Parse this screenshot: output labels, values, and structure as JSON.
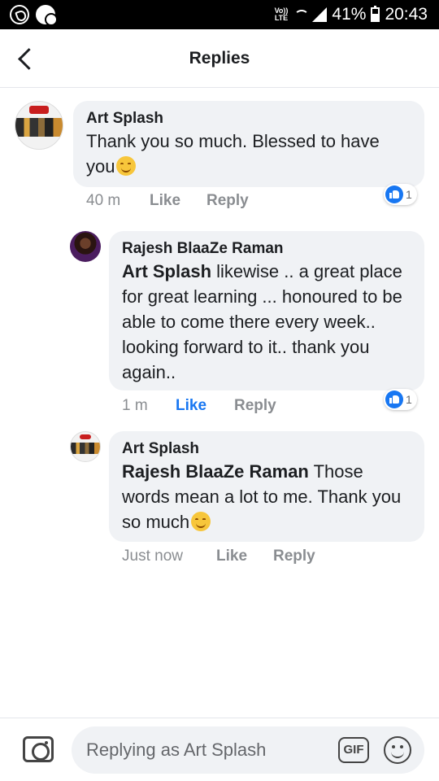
{
  "status_bar": {
    "volte_line1": "Vo))",
    "volte_line2": "LTE",
    "battery": "41%",
    "time": "20:43",
    "icons": [
      "whatsapp-icon",
      "chat-icon",
      "volte-icon",
      "wifi-icon",
      "signal-icon",
      "battery-icon"
    ]
  },
  "header": {
    "title": "Replies",
    "back_icon": "chevron-left-icon"
  },
  "comments": [
    {
      "author": "Art Splash",
      "avatar": "art-splash-avatar",
      "text_prefix": "Thank you so much. Blessed to have you",
      "emoji": "smiling-face-emoji",
      "time": "40 m",
      "like_label": "Like",
      "like_active": false,
      "reply_label": "Reply",
      "reaction_count": "1"
    },
    {
      "author": "Rajesh BlaaZe Raman",
      "avatar": "rajesh-avatar",
      "mention": "Art Splash",
      "text": " likewise .. a great place for great learning ... honoured to be able to come there every week.. looking forward to it.. thank you again..",
      "time": "1 m",
      "like_label": "Like",
      "like_active": true,
      "reply_label": "Reply",
      "reaction_count": "1"
    },
    {
      "author": "Art Splash",
      "avatar": "art-splash-avatar",
      "mention": "Rajesh BlaaZe Raman",
      "text": " Those words mean a lot to me. Thank you so much",
      "emoji": "smiling-face-emoji",
      "time": "Just now",
      "like_label": "Like",
      "like_active": false,
      "reply_label": "Reply"
    }
  ],
  "composer": {
    "placeholder": "Replying as Art Splash",
    "gif_label": "GIF",
    "camera_icon": "camera-icon",
    "emoji_icon": "emoji-icon"
  },
  "colors": {
    "accent": "#1877f2",
    "bubble": "#f0f2f5",
    "secondary_text": "#8a8d91"
  }
}
